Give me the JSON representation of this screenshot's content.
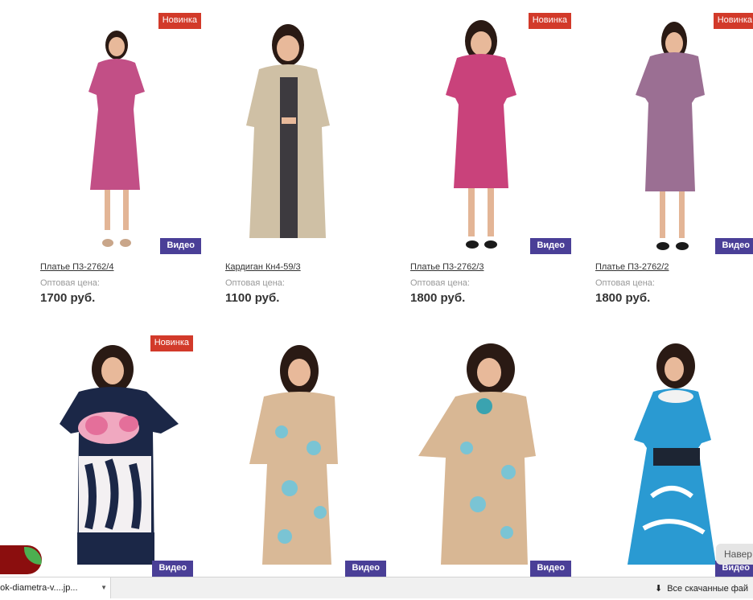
{
  "labels": {
    "new_badge": "Новинка",
    "video_button": "Видео",
    "wholesale_price": "Оптовая цена:"
  },
  "products": [
    {
      "name": "Платье П3-2762/4",
      "price": "1700 руб.",
      "is_new": true,
      "dress_color": "#c24f86"
    },
    {
      "name": "Кардиган Кн4-59/3",
      "price": "1100 руб.",
      "is_new": false,
      "dress_color": "#cfc0a5"
    },
    {
      "name": "Платье П3-2762/3",
      "price": "1800 руб.",
      "is_new": true,
      "dress_color": "#c9427b"
    },
    {
      "name": "Платье П3-2762/2",
      "price": "1800 руб.",
      "is_new": true,
      "dress_color": "#9b6f93"
    },
    {
      "name": "",
      "price": "",
      "is_new": true,
      "dress_color": "#1b2747"
    },
    {
      "name": "",
      "price": "",
      "is_new": false,
      "dress_color": "#d9b997"
    },
    {
      "name": "",
      "price": "",
      "is_new": false,
      "dress_color": "#d8b794"
    },
    {
      "name": "",
      "price": "",
      "is_new": false,
      "dress_color": "#2a9ad2"
    }
  ],
  "download_bar": {
    "file_name": "nok-diametra-v....jp...",
    "show_all": "Все скачанные фай"
  },
  "scroll_up_tab": "Навер",
  "colors": {
    "badge_new": "#d23a2a",
    "video_button": "#4a3f97"
  }
}
